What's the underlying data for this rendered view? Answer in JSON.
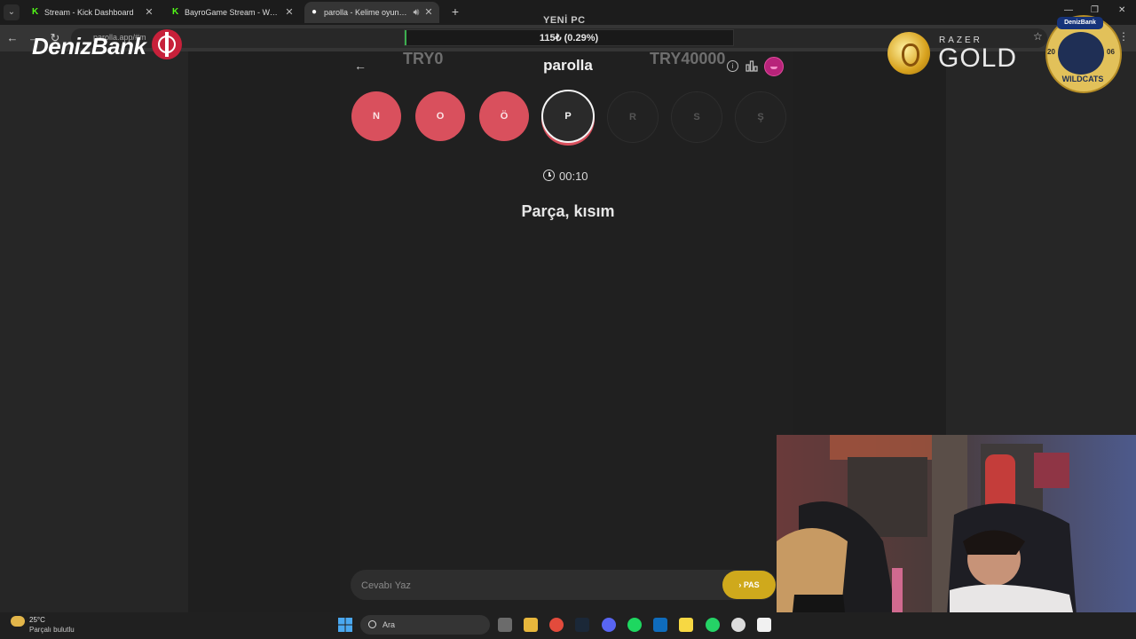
{
  "browser": {
    "tabs": [
      {
        "title": "Stream - Kick Dashboard",
        "favicon": "kick-icon",
        "active": false
      },
      {
        "title": "BayroGame Stream - Watch Live",
        "favicon": "kick-icon",
        "active": false
      },
      {
        "title": "parolla - Kelime oyunu. Günlük",
        "favicon": "parolla-icon",
        "active": true
      }
    ],
    "url": "parolla.app/#m"
  },
  "overlay": {
    "brand": "DenizBank",
    "top_banner": "YENİ PC",
    "goal_text": "115₺ (0.29%)",
    "goal_progress_percent": 0.29,
    "goal_left": "TRY0",
    "goal_right": "TRY40000",
    "sponsor_small": "RAZER",
    "sponsor_big": "GOLD",
    "badge_top": "DenizBank",
    "badge_left": "20",
    "badge_right": "06",
    "badge_bottom": "WILDCATS"
  },
  "app": {
    "title": "parolla",
    "letters": [
      {
        "char": "N",
        "state": "done"
      },
      {
        "char": "O",
        "state": "done"
      },
      {
        "char": "Ö",
        "state": "done"
      },
      {
        "char": "P",
        "state": "current"
      },
      {
        "char": "R",
        "state": "pending"
      },
      {
        "char": "S",
        "state": "pending"
      },
      {
        "char": "Ş",
        "state": "pending"
      }
    ],
    "timer": "00:10",
    "clue": "Parça, kısım",
    "answer_placeholder": "Cevabı Yaz",
    "pass_label": "PAS",
    "colors": {
      "done": "#d9505d",
      "pass": "#cfa91c"
    }
  },
  "taskbar": {
    "temp": "25°C",
    "weather": "Parçalı bulutlu",
    "search_label": "Ara"
  }
}
